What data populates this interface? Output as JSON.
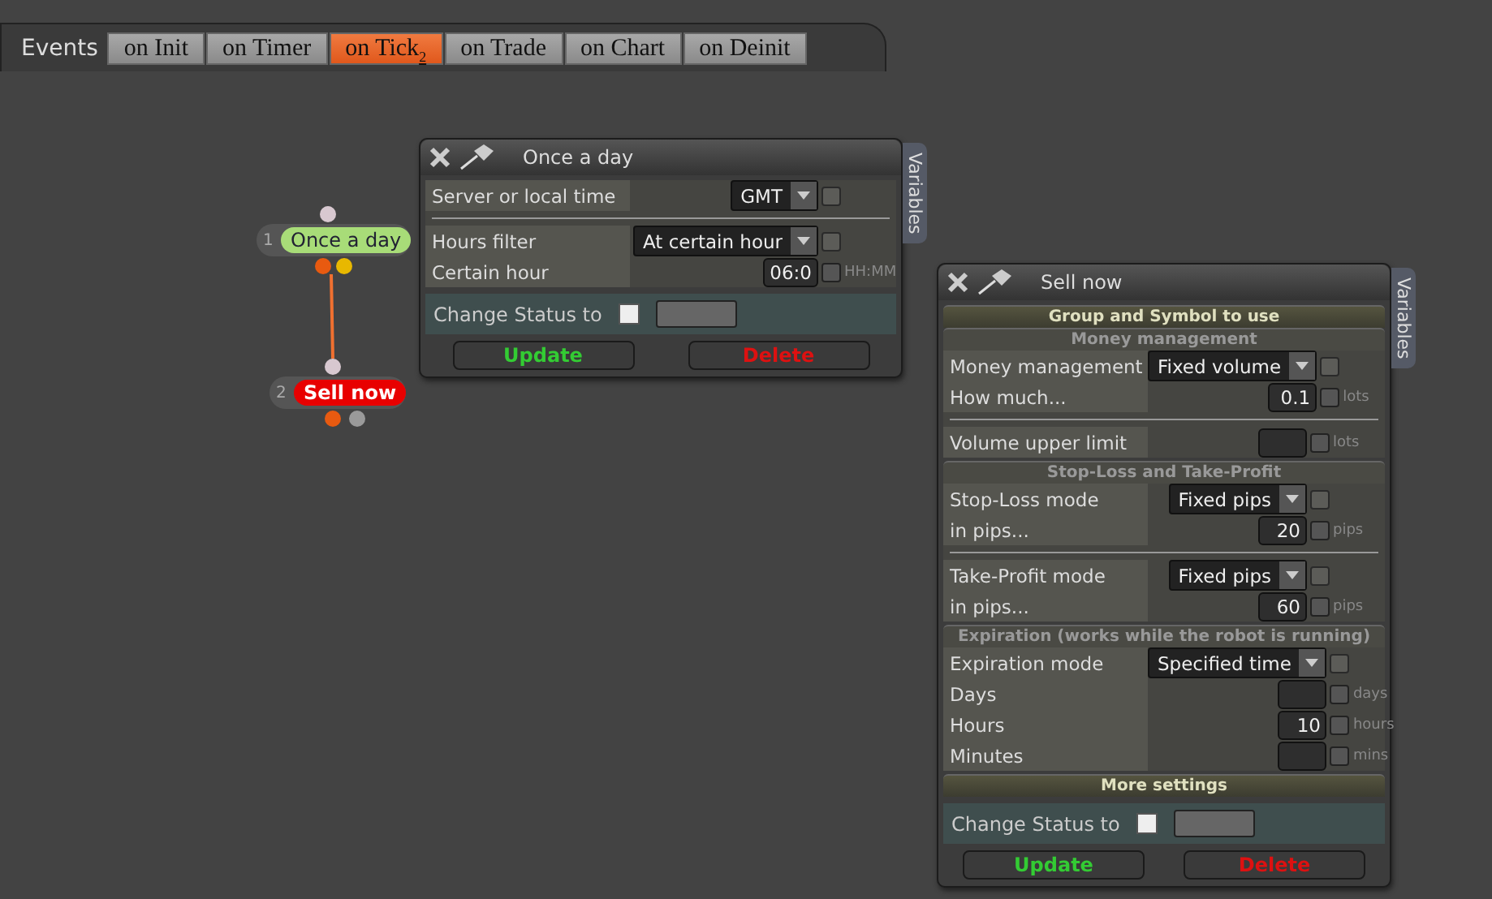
{
  "events_label": "Events",
  "tabs": [
    {
      "label": "on Init",
      "selected": false
    },
    {
      "label": "on Timer",
      "selected": false
    },
    {
      "label": "on Tick",
      "badge": "2",
      "selected": true
    },
    {
      "label": "on Trade",
      "selected": false
    },
    {
      "label": "on Chart",
      "selected": false
    },
    {
      "label": "on Deinit",
      "selected": false
    }
  ],
  "nodes": [
    {
      "number": "1",
      "label": "Once a day",
      "color": "#a8dc78"
    },
    {
      "number": "2",
      "label": "Sell now",
      "color": "#e80000"
    }
  ],
  "windows": [
    {
      "title": "Once a day",
      "side_tab": "Variables",
      "sections": [
        {
          "groups": [
            [
              {
                "kind": "select",
                "label": "Server or local time",
                "value": "GMT",
                "checked": false
              }
            ],
            [
              {
                "kind": "select",
                "label": "Hours filter",
                "value": "At certain hour",
                "checked": false
              },
              {
                "kind": "number",
                "label": "Certain hour",
                "value": "06:0",
                "unit": "HH:MM",
                "checked": false
              }
            ]
          ]
        }
      ],
      "change_status": {
        "label": "Change Status to",
        "checked": false
      },
      "update": "Update",
      "delete": "Delete"
    },
    {
      "title": "Sell now",
      "side_tab": "Variables",
      "sections": [
        {
          "heading": "Group and Symbol to use",
          "expanded": false
        },
        {
          "heading": "Money management",
          "expanded": true,
          "groups": [
            [
              {
                "kind": "select",
                "label": "Money management",
                "value": "Fixed volume",
                "checked": false
              },
              {
                "kind": "number",
                "label": "How much...",
                "value": "0.1",
                "unit": "lots",
                "checked": false
              }
            ],
            [
              {
                "kind": "number",
                "label": "Volume upper limit",
                "unit": "lots",
                "checked": false
              }
            ]
          ]
        },
        {
          "heading": "Stop-Loss and Take-Profit",
          "expanded": true,
          "groups": [
            [
              {
                "kind": "select",
                "label": "Stop-Loss mode",
                "value": "Fixed pips",
                "checked": false
              },
              {
                "kind": "number",
                "label": "in pips...",
                "value": "20",
                "unit": "pips",
                "checked": false
              }
            ],
            [
              {
                "kind": "select",
                "label": "Take-Profit mode",
                "value": "Fixed pips",
                "checked": false
              },
              {
                "kind": "number",
                "label": "in pips...",
                "value": "60",
                "unit": "pips",
                "checked": false
              }
            ]
          ]
        },
        {
          "heading": "Expiration (works while the robot is running)",
          "expanded": true,
          "groups": [
            [
              {
                "kind": "select",
                "label": "Expiration mode",
                "value": "Specified time",
                "checked": false
              },
              {
                "kind": "number",
                "label": "Days",
                "unit": "days",
                "checked": false
              },
              {
                "kind": "number",
                "label": "Hours",
                "value": "10",
                "unit": "hours",
                "checked": false
              },
              {
                "kind": "number",
                "label": "Minutes",
                "unit": "mins",
                "checked": false
              }
            ]
          ]
        },
        {
          "heading": "More settings",
          "expanded": false
        }
      ],
      "change_status": {
        "label": "Change Status to",
        "checked": false
      },
      "update": "Update",
      "delete": "Delete"
    }
  ]
}
